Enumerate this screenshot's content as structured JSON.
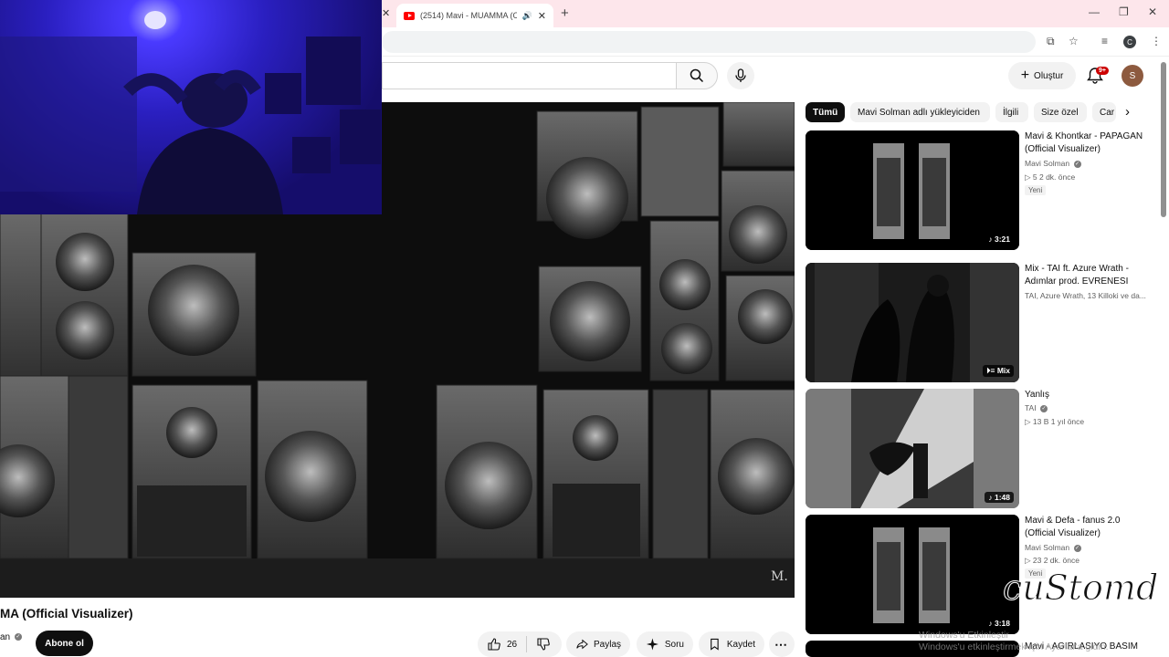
{
  "browser": {
    "active_tab": "(2514) Mavi - MUAMMA (O",
    "profile_letter": "C"
  },
  "youtube": {
    "create_label": "Oluştur",
    "notif_count": "9+",
    "avatar_letter": "S"
  },
  "video": {
    "title": "MA (Official Visualizer)",
    "channel_fragment": "an",
    "subscribe_label": "Abone ol",
    "watermark": "M.",
    "likes": "26",
    "share_label": "Paylaş",
    "ask_label": "Soru",
    "save_label": "Kaydet"
  },
  "chips": [
    "Tümü",
    "Mavi Solman adlı yükleyiciden",
    "İlgili",
    "Size özel",
    "Car"
  ],
  "recommendations": [
    {
      "title": "Mavi & Khontkar - PAPAGAN (Official Visualizer)",
      "channel": "Mavi Solman",
      "meta": "5   2 dk. önce",
      "badge": "Yeni",
      "duration": "3:21"
    },
    {
      "title": "Mix - TAI ft. Azure Wrath - Adımlar prod. EVRENESI",
      "channel": "TAI, Azure Wrath, 13 Killoki ve da...",
      "duration": "Mix"
    },
    {
      "title": "Yanlış",
      "channel": "TAI",
      "meta": "13 B   1 yıl önce",
      "duration": "1:48"
    },
    {
      "title": "Mavi & Defa - fanus 2.0 (Official Visualizer)",
      "channel": "Mavi Solman",
      "meta": "23   2 dk. önce",
      "badge": "Yeni",
      "duration": "3:18"
    },
    {
      "title": "Mavi - AGIRLASIYO BASIM"
    }
  ],
  "overlay": {
    "logo_text": "cuStomd",
    "activation_line1": "Windows'u Etkinleştir",
    "activation_line2": "Windows'u etkinleştirmek için Ayarlar'a gidin."
  }
}
